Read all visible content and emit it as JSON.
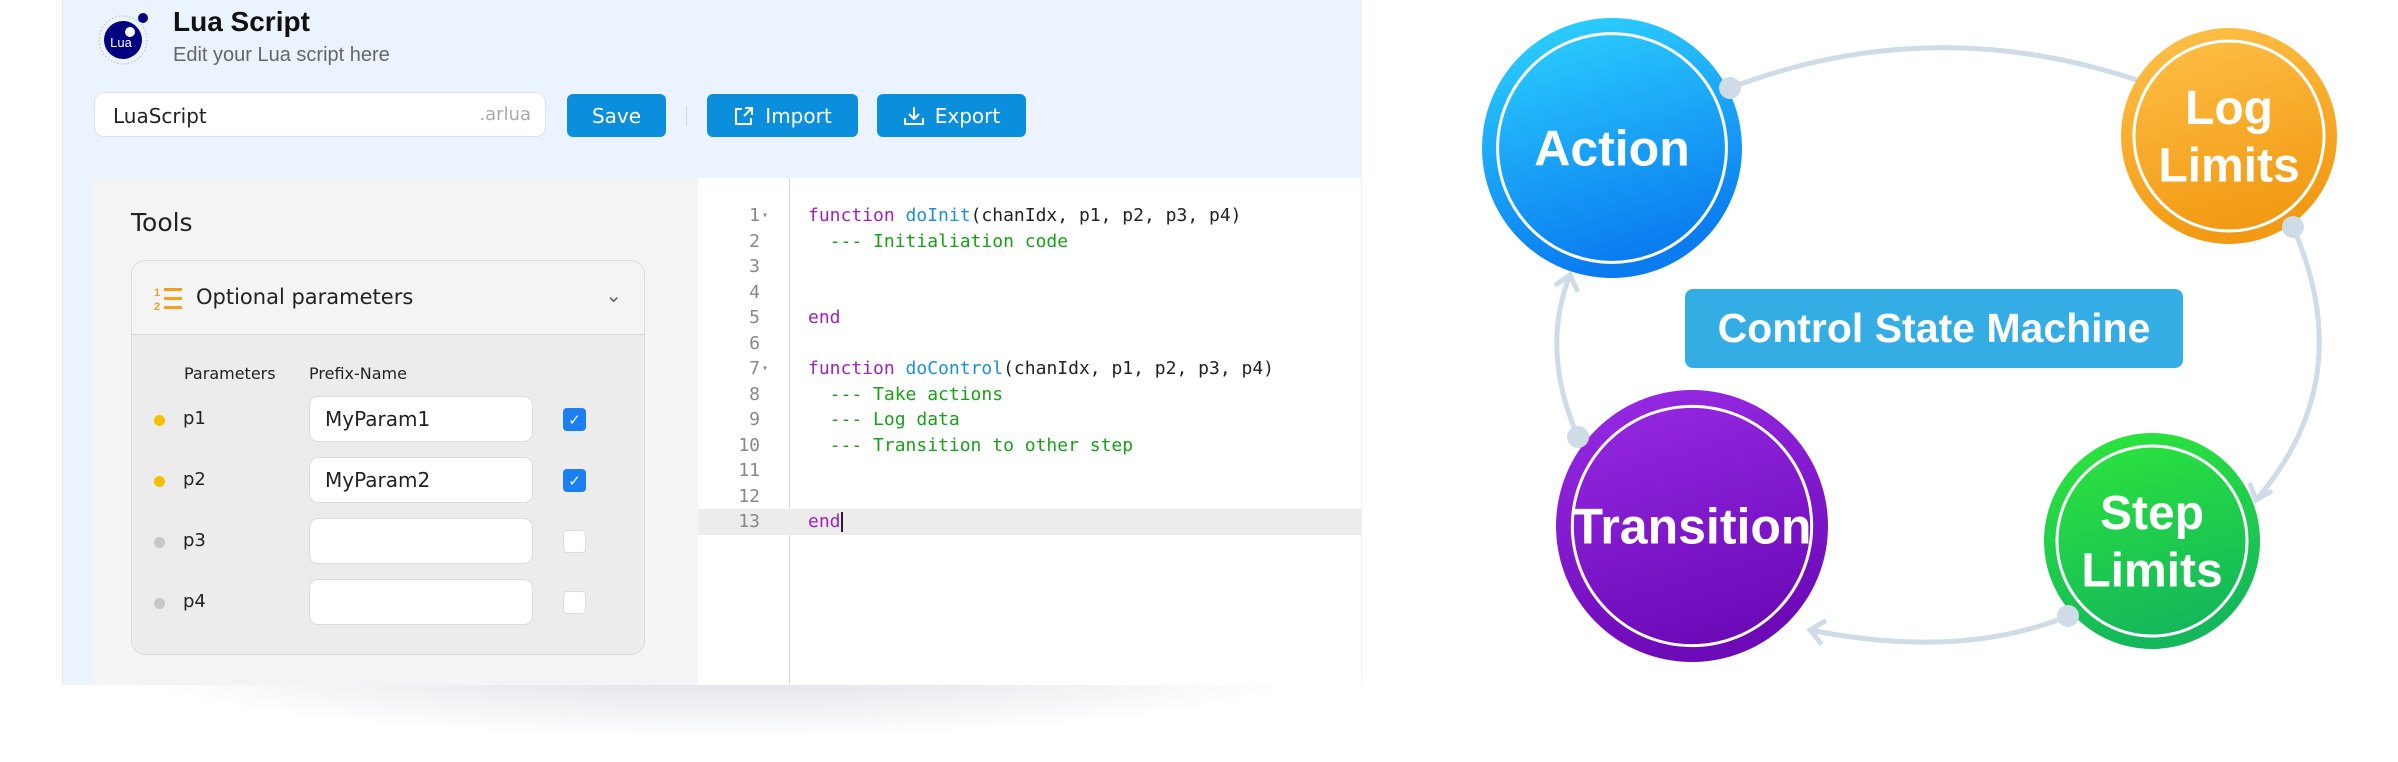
{
  "header": {
    "logo_text": "Lua",
    "title": "Lua Script",
    "subtitle": "Edit your Lua script here"
  },
  "toolbar": {
    "filename_value": "LuaScript",
    "extension": ".arlua",
    "save_label": "Save",
    "import_label": "Import",
    "export_label": "Export",
    "import_icon": "external-link-icon",
    "export_icon": "download-icon"
  },
  "tools": {
    "title": "Tools",
    "section_label": "Optional parameters",
    "section_icon": "numbered-list-icon",
    "columns": [
      "Parameters",
      "Prefix-Name"
    ],
    "params": [
      {
        "name": "p1",
        "prefix": "MyParam1",
        "enabled": true,
        "status_color": "#f5c000"
      },
      {
        "name": "p2",
        "prefix": "MyParam2",
        "enabled": true,
        "status_color": "#f5c000"
      },
      {
        "name": "p3",
        "prefix": "",
        "enabled": false,
        "status_color": "#c8c8cc"
      },
      {
        "name": "p4",
        "prefix": "",
        "enabled": false,
        "status_color": "#c8c8cc"
      }
    ]
  },
  "editor": {
    "active_line": 13,
    "lines": [
      {
        "n": "1",
        "fold": true,
        "tokens": [
          [
            "kw",
            "function "
          ],
          [
            "fn",
            "doInit"
          ],
          [
            "tx",
            "(chanIdx, p1, p2, p3, p4)"
          ]
        ]
      },
      {
        "n": "2",
        "fold": false,
        "tokens": [
          [
            "cm",
            "  --- Initialiation code"
          ]
        ]
      },
      {
        "n": "3",
        "fold": false,
        "tokens": []
      },
      {
        "n": "4",
        "fold": false,
        "tokens": []
      },
      {
        "n": "5",
        "fold": false,
        "tokens": [
          [
            "kw",
            "end"
          ]
        ]
      },
      {
        "n": "6",
        "fold": false,
        "tokens": []
      },
      {
        "n": "7",
        "fold": true,
        "tokens": [
          [
            "kw",
            "function "
          ],
          [
            "fn",
            "doControl"
          ],
          [
            "tx",
            "(chanIdx, p1, p2, p3, p4)"
          ]
        ]
      },
      {
        "n": "8",
        "fold": false,
        "tokens": [
          [
            "cm",
            "  --- Take actions"
          ]
        ]
      },
      {
        "n": "9",
        "fold": false,
        "tokens": [
          [
            "cm",
            "  --- Log data"
          ]
        ]
      },
      {
        "n": "10",
        "fold": false,
        "tokens": [
          [
            "cm",
            "  --- Transition to other step"
          ]
        ]
      },
      {
        "n": "11",
        "fold": false,
        "tokens": []
      },
      {
        "n": "12",
        "fold": false,
        "tokens": []
      },
      {
        "n": "13",
        "fold": false,
        "tokens": [
          [
            "kw",
            "end"
          ]
        ]
      }
    ]
  },
  "diagram": {
    "title": "Control State Machine",
    "title_color": "#34ade4",
    "nodes": [
      {
        "id": "action",
        "lines": [
          "Action"
        ],
        "color": "#1a9cf0"
      },
      {
        "id": "log-limits",
        "lines": [
          "Log",
          "Limits"
        ],
        "color": "#f7a823"
      },
      {
        "id": "step-limits",
        "lines": [
          "Step",
          "Limits"
        ],
        "color": "#22c84a"
      },
      {
        "id": "transition",
        "lines": [
          "Transition"
        ],
        "color": "#8a1cd8"
      }
    ],
    "edges": [
      {
        "from": "action",
        "to": "log-limits"
      },
      {
        "from": "log-limits",
        "to": "step-limits"
      },
      {
        "from": "step-limits",
        "to": "transition"
      },
      {
        "from": "transition",
        "to": "action"
      }
    ],
    "edge_color": "#d0dbe8"
  }
}
